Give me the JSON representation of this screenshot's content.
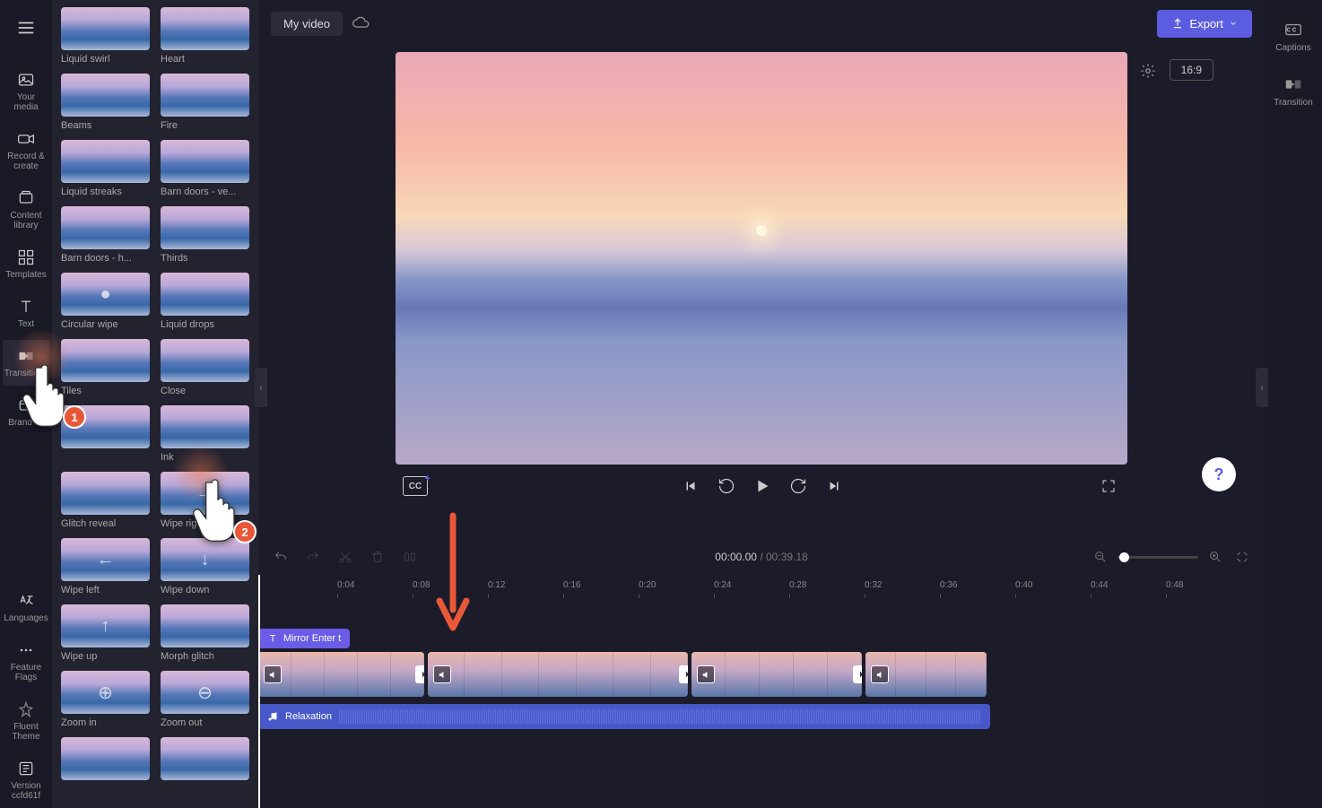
{
  "rail": {
    "items": [
      {
        "label": "Your media",
        "icon": "photo"
      },
      {
        "label": "Record & create",
        "icon": "camera"
      },
      {
        "label": "Content library",
        "icon": "library"
      },
      {
        "label": "Templates",
        "icon": "grid"
      },
      {
        "label": "Text",
        "icon": "text"
      },
      {
        "label": "Transitions",
        "icon": "transition",
        "active": true
      },
      {
        "label": "Brand kit",
        "icon": "brand"
      }
    ],
    "bottom": [
      {
        "label": "Languages",
        "icon": "lang"
      },
      {
        "label": "Feature Flags",
        "icon": "dots"
      },
      {
        "label": "Fluent Theme",
        "icon": "theme"
      },
      {
        "label": "Version ccfd61f",
        "icon": "version"
      }
    ]
  },
  "transitions": [
    "Liquid swirl",
    "Heart",
    "Beams",
    "Fire",
    "Liquid streaks",
    "Barn doors - ve...",
    "Barn doors - h...",
    "Thirds",
    "Circular wipe",
    "Liquid drops",
    "Tiles",
    "Close",
    "",
    "Ink",
    "Glitch reveal",
    "Wipe right",
    "Wipe left",
    "Wipe down",
    "Wipe up",
    "Morph glitch",
    "Zoom in",
    "Zoom out",
    "",
    ""
  ],
  "header": {
    "title": "My video",
    "export": "Export",
    "ratio": "16:9"
  },
  "controls": {
    "cc": "CC"
  },
  "timeline": {
    "current": "00:00.00",
    "duration": "00:39.18",
    "ticks": [
      "0:04",
      "0:08",
      "0:12",
      "0:16",
      "0:20",
      "0:24",
      "0:28",
      "0:32",
      "0:36",
      "0:40",
      "0:44",
      "0:48"
    ],
    "text_clip": "Mirror Enter t",
    "audio": "Relaxation"
  },
  "right_rail": {
    "captions": "Captions",
    "transition": "Transition"
  },
  "annotations": {
    "badge1": "1",
    "badge2": "2"
  }
}
